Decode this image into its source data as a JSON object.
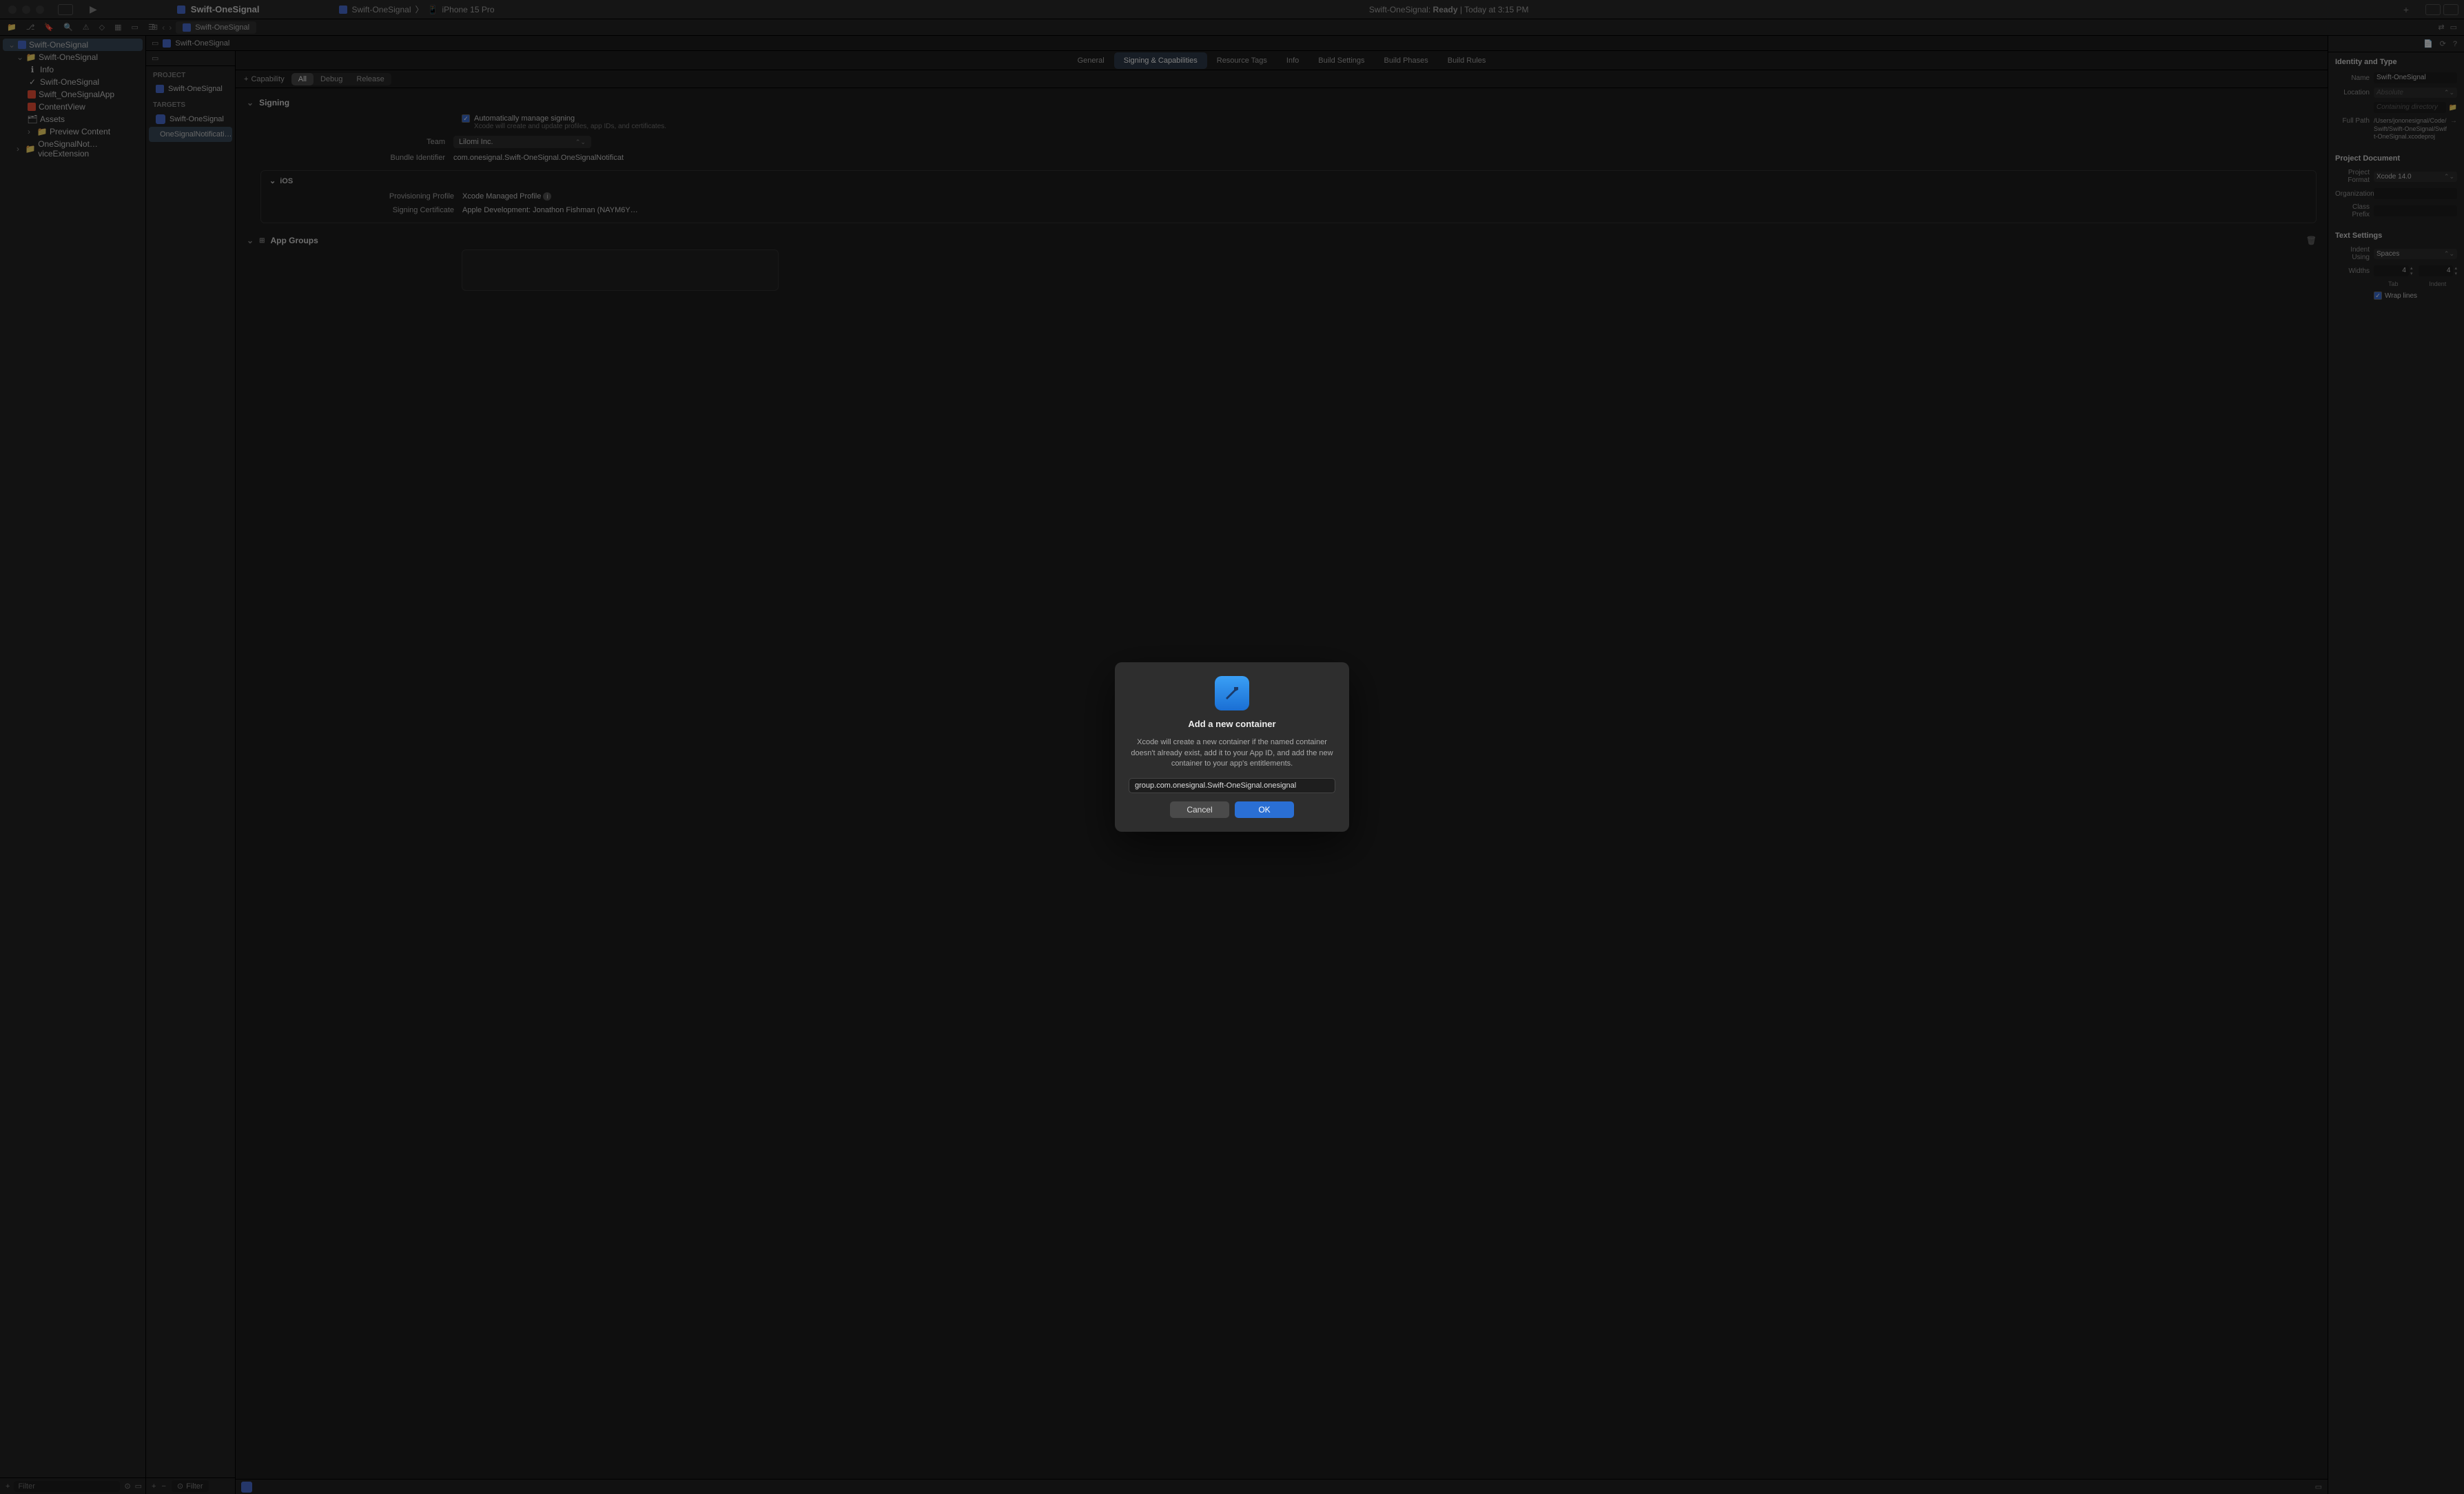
{
  "titlebar": {
    "project_name": "Swift-OneSignal",
    "scheme": "Swift-OneSignal",
    "device": "iPhone 15 Pro",
    "status_prefix": "Swift-OneSignal:",
    "status_ready": "Ready",
    "status_time": "Today at 3:15 PM"
  },
  "tab": {
    "label": "Swift-OneSignal"
  },
  "breadcrumb": {
    "project": "Swift-OneSignal"
  },
  "navigator": {
    "root": "Swift-OneSignal",
    "items": [
      {
        "label": "Swift-OneSignal",
        "type": "folder"
      },
      {
        "label": "Info",
        "type": "plist"
      },
      {
        "label": "Swift-OneSignal",
        "type": "folder"
      },
      {
        "label": "Swift_OneSignalApp",
        "type": "swift"
      },
      {
        "label": "ContentView",
        "type": "swift"
      },
      {
        "label": "Assets",
        "type": "assets"
      },
      {
        "label": "Preview Content",
        "type": "folder"
      },
      {
        "label": "OneSignalNot…viceExtension",
        "type": "folder"
      }
    ],
    "filter_placeholder": "Filter"
  },
  "targets": {
    "project_header": "PROJECT",
    "project_item": "Swift-OneSignal",
    "targets_header": "TARGETS",
    "items": [
      {
        "label": "Swift-OneSignal",
        "type": "app"
      },
      {
        "label": "OneSignalNotificati…",
        "type": "ext"
      }
    ],
    "filter_placeholder": "Filter"
  },
  "editor_tabs": [
    "General",
    "Signing & Capabilities",
    "Resource Tags",
    "Info",
    "Build Settings",
    "Build Phases",
    "Build Rules"
  ],
  "editor_tabs_active": 1,
  "capability_bar": {
    "add_capability": "Capability",
    "segments": [
      "All",
      "Debug",
      "Release"
    ],
    "active_segment": 0
  },
  "signing": {
    "section_title": "Signing",
    "auto_manage_label": "Automatically manage signing",
    "auto_manage_hint": "Xcode will create and update profiles, app IDs, and certificates.",
    "team_label": "Team",
    "team_value": "Lilomi Inc.",
    "bundle_label": "Bundle Identifier",
    "bundle_value": "com.onesignal.Swift-OneSignal.OneSignalNotificat",
    "ios_title": "iOS",
    "provisioning_label": "Provisioning Profile",
    "provisioning_value": "Xcode Managed Profile",
    "cert_label": "Signing Certificate",
    "cert_value": "Apple Development: Jonathon Fishman (NAYM6Y…"
  },
  "app_groups": {
    "section_title": "App Groups"
  },
  "inspector": {
    "identity_header": "Identity and Type",
    "name_label": "Name",
    "name_value": "Swift-OneSignal",
    "location_label": "Location",
    "location_value": "Absolute",
    "containing_placeholder": "Containing directory",
    "fullpath_label": "Full Path",
    "fullpath_value": "/Users/jononesignal/Code/Swift/Swift-OneSignal/Swift-OneSignal.xcodeproj",
    "document_header": "Project Document",
    "format_label": "Project Format",
    "format_value": "Xcode 14.0",
    "org_label": "Organization",
    "prefix_label": "Class Prefix",
    "text_header": "Text Settings",
    "indent_using_label": "Indent Using",
    "indent_using_value": "Spaces",
    "widths_label": "Widths",
    "tab_width": "4",
    "indent_width": "4",
    "tab_caption": "Tab",
    "indent_caption": "Indent",
    "wrap_label": "Wrap lines"
  },
  "modal": {
    "title": "Add a new container",
    "description": "Xcode will create a new container if the named container doesn't already exist, add it to your App ID, and add the new container to your app's entitlements.",
    "input_value": "group.com.onesignal.Swift-OneSignal.onesignal",
    "cancel": "Cancel",
    "ok": "OK"
  }
}
